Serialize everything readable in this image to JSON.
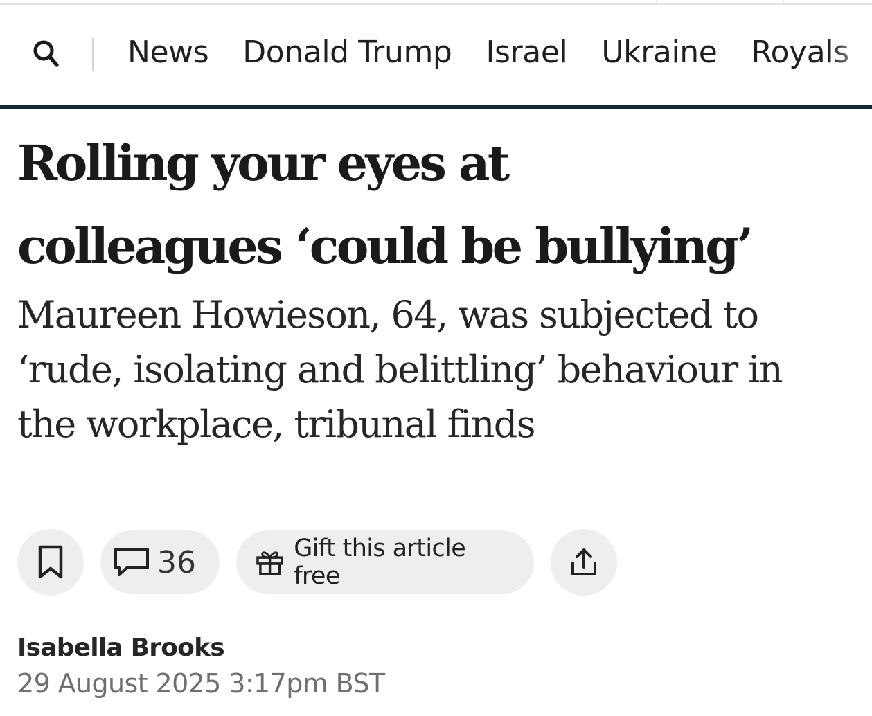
{
  "nav": {
    "search_icon": "search-icon",
    "items": [
      "News",
      "Donald Trump",
      "Israel",
      "Ukraine",
      "Royals"
    ],
    "rule_color": "#0f2a33"
  },
  "article": {
    "headline_line1": "Rolling your eyes at",
    "headline_line2": "colleagues ‘could be bullying’",
    "standfirst": "Maureen Howieson, 64, was subjected to ‘rude, isolating and belittling’ behaviour in the workplace, tribunal finds"
  },
  "actions": {
    "bookmark_icon": "bookmark-icon",
    "comment_icon": "comment-icon",
    "comment_count": "36",
    "gift_icon": "gift-icon",
    "gift_label": "Gift this article free",
    "share_icon": "share-icon"
  },
  "byline": {
    "author": "Isabella Brooks",
    "date": "29 August 2025 3:17pm BST"
  }
}
